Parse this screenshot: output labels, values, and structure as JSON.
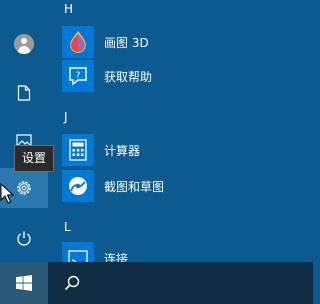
{
  "start_menu": {
    "sidebar": {
      "settings_tooltip": "设置"
    },
    "groups": [
      {
        "letter": "H",
        "apps": [
          {
            "label": "画图 3D",
            "icon": "paint-3d-icon"
          },
          {
            "label": "获取帮助",
            "icon": "get-help-icon"
          }
        ]
      },
      {
        "letter": "J",
        "apps": [
          {
            "label": "计算器",
            "icon": "calculator-icon"
          },
          {
            "label": "截图和草图",
            "icon": "snip-sketch-icon"
          }
        ]
      },
      {
        "letter": "L",
        "apps": [
          {
            "label": "连接",
            "icon": "connect-icon"
          }
        ]
      }
    ]
  },
  "colors": {
    "start_bg": "#0c5a8f",
    "taskbar_bg": "#0e2d43",
    "tile_blue": "#0078d7",
    "hover": "#2a78ad",
    "tooltip_bg": "#2b2b2b"
  }
}
